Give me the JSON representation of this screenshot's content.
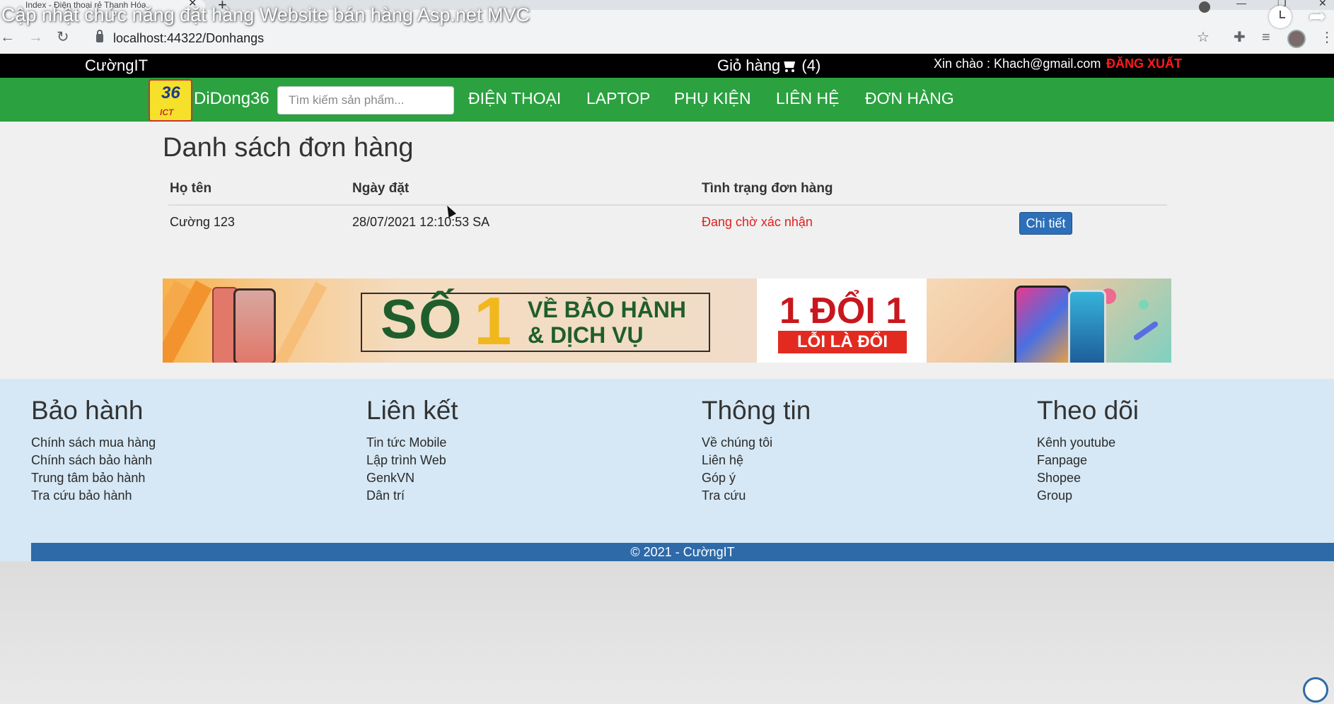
{
  "video": {
    "title": "Cập nhật chức năng đặt hàng Website bán hàng Asp.net MVC"
  },
  "browser": {
    "tab_title": "Index - Điện thoại rẻ Thanh Hóa",
    "url": "localhost:44322/Donhangs"
  },
  "topbar": {
    "brand": "CườngIT",
    "cart_label": "Giỏ hàng",
    "cart_count": "(4)",
    "greeting": "Xin chào : Khach@gmail.com",
    "logout": "ĐĂNG XUẤT"
  },
  "navbar": {
    "logo_number": "36",
    "logo_text": "ICT",
    "site_name": "DiDong36",
    "search_placeholder": "Tìm kiếm sản phẩm...",
    "items": [
      {
        "label": "ĐIỆN THOẠI"
      },
      {
        "label": "LAPTOP"
      },
      {
        "label": "PHỤ KIỆN"
      },
      {
        "label": "LIÊN HỆ"
      },
      {
        "label": "ĐƠN HÀNG"
      }
    ]
  },
  "main": {
    "title": "Danh sách đơn hàng",
    "columns": [
      "Họ tên",
      "Ngày đặt",
      "Tình trạng đơn hàng"
    ],
    "rows": [
      {
        "name": "Cường 123",
        "date": "28/07/2021 12:10:53 SA",
        "status": "Đang chờ xác nhận",
        "action": "Chi tiết"
      }
    ],
    "status_color": "#e02020"
  },
  "banner": {
    "so": "SỐ",
    "one": "1",
    "line1": "VỀ BẢO HÀNH",
    "line2": "& DỊCH VỤ",
    "doi": "1 ĐỔI 1",
    "loi": "LỖI LÀ ĐỔI"
  },
  "footer": {
    "columns": [
      {
        "heading": "Bảo hành",
        "links": [
          "Chính sách mua hàng",
          "Chính sách bảo hành",
          "Trung tâm bảo hành",
          "Tra cứu bảo hành"
        ]
      },
      {
        "heading": "Liên kết",
        "links": [
          "Tin tức Mobile",
          "Lập trình Web",
          "GenkVN",
          "Dân trí"
        ]
      },
      {
        "heading": "Thông tin",
        "links": [
          "Về chúng tôi",
          "Liên hệ",
          "Góp ý",
          "Tra cứu"
        ]
      },
      {
        "heading": "Theo dõi",
        "links": [
          "Kênh youtube",
          "Fanpage",
          "Shopee",
          "Group"
        ]
      }
    ],
    "copyright": "© 2021 - CườngIT"
  },
  "colors": {
    "navbar": "#2ba140",
    "topbar": "#000000",
    "logout": "#ff1a1a",
    "button": "#2d6fb8",
    "footer_bg": "#d6e8f5",
    "copyright_bar": "#2f6aa8"
  }
}
